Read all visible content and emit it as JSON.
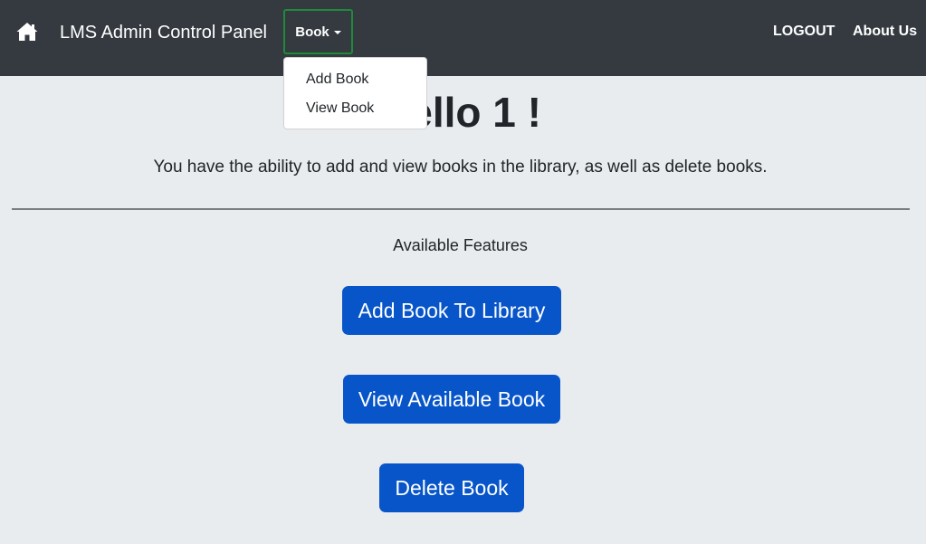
{
  "navbar": {
    "home_icon": "home-icon",
    "brand": "LMS Admin Control Panel",
    "book_menu_label": "Book",
    "logout_label": "LOGOUT",
    "about_label": "About Us",
    "active_outline_color": "#1e8a3a",
    "background_color": "#343a40"
  },
  "dropdown": {
    "items": [
      {
        "label": "Add Book"
      },
      {
        "label": "View Book"
      }
    ]
  },
  "main": {
    "heading": "Hello 1 !",
    "description": "You have the ability to add and view books in the library, as well as delete books.",
    "features_label": "Available Features",
    "buttons": {
      "add": "Add Book To Library",
      "view": "View Available Book",
      "delete": "Delete Book"
    },
    "button_color": "#0755c9",
    "page_background": "#e9ecef"
  }
}
